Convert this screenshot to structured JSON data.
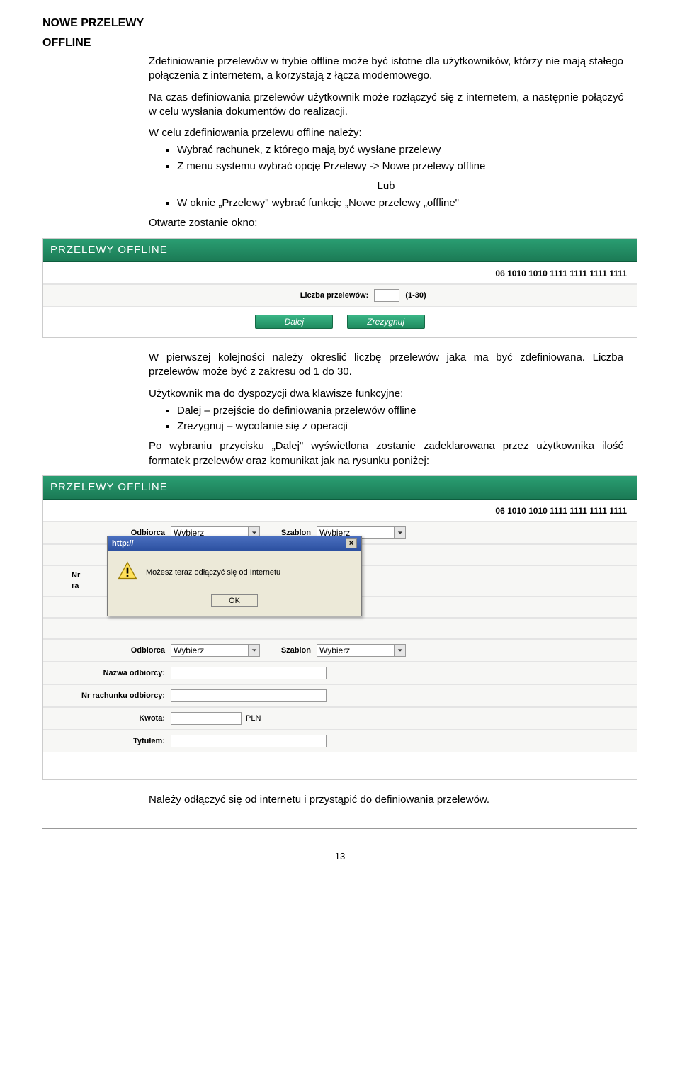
{
  "heading1": "NOWE PRZELEWY",
  "heading2": "OFFLINE",
  "intro1": "Zdefiniowanie przelewów w trybie offline może być istotne dla użytkowników, którzy nie mają stałego połączenia z internetem, a korzystają z łącza modemowego.",
  "intro2": "Na czas definiowania przelewów użytkownik może rozłączyć się z internetem, a następnie połączyć w celu wysłania dokumentów do realizacji.",
  "steps_lead": "W celu zdefiniowania przelewu offline należy:",
  "steps": {
    "s1": "Wybrać rachunek, z którego mają być wysłane przelewy",
    "s2": "Z menu systemu wybrać opcję Przelewy -> Nowe przelewy offline",
    "s3": "W oknie „Przelewy\" wybrać funkcję „Nowe przelewy „offline\""
  },
  "lub": "Lub",
  "open_window": "Otwarte zostanie okno:",
  "panel": {
    "title": "PRZELEWY OFFLINE",
    "account": "06 1010 1010 1111 1111 1111 1111",
    "count_label": "Liczba przelewów:",
    "count_hint": "(1-30)",
    "btn_next": "Dalej",
    "btn_cancel": "Zrezygnuj"
  },
  "after1": "W pierwszej kolejności należy okreslić liczbę przelewów jaka ma być zdefiniowana. Liczba przelewów może być z zakresu od 1 do 30.",
  "func_lead": "Użytkownik ma do dyspozycji dwa klawisze funkcyjne:",
  "func": {
    "f1": "Dalej – przejście do definiowania przelewów offline",
    "f2": "Zrezygnuj – wycofanie się z operacji"
  },
  "after2": "Po wybraniu przycisku „Dalej\" wyświetlona zostanie zadeklarowana przez użytkownika ilość formatek przelewów oraz komunikat jak na rysunku poniżej:",
  "form": {
    "odbiorca": "Odbiorca",
    "szablon": "Szablon",
    "select_ph": "Wybierz",
    "nazwa": "Nazwa odbiorcy:",
    "nr_short": "Nr ra",
    "nr": "Nr rachunku odbiorcy:",
    "kwota": "Kwota:",
    "pln": "PLN",
    "tytulem": "Tytułem:"
  },
  "dialog": {
    "title": "http://",
    "msg": "Możesz teraz odłączyć się od Internetu",
    "ok": "OK"
  },
  "closing": "Należy odłączyć się od internetu i przystąpić do definiowania przelewów.",
  "page_no": "13"
}
